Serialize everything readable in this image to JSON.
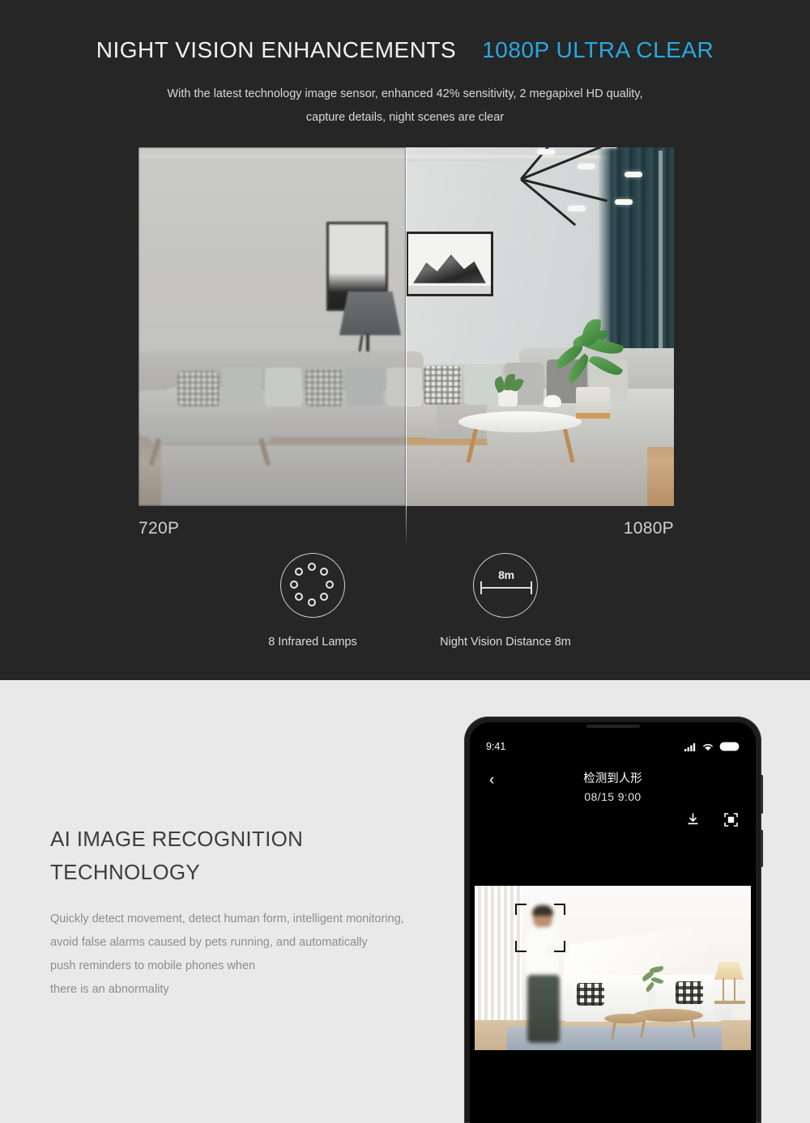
{
  "theme": {
    "dark_bg": "#262626",
    "light_bg": "#E9E9E9",
    "accent_blue": "#29A8E0",
    "heading_light": "#F2F2F2",
    "body_muted": "#8D8D8D"
  },
  "night_vision": {
    "headline_main": "NIGHT VISION ENHANCEMENTS",
    "headline_accent": "1080P ULTRA CLEAR",
    "subhead_line1": "With the latest technology image sensor, enhanced 42% sensitivity, 2 megapixel HD quality,",
    "subhead_line2": "capture details, night scenes are clear",
    "comparison": {
      "left_label": "720P",
      "right_label": "1080P"
    },
    "features": [
      {
        "icon": "infrared-lamps-icon",
        "caption": "8 Infrared Lamps",
        "lamp_count": 8
      },
      {
        "icon": "night-vision-distance-icon",
        "caption": "Night Vision Distance 8m",
        "distance_label": "8m"
      }
    ]
  },
  "ai_recognition": {
    "title_line1": "AI IMAGE RECOGNITION",
    "title_line2": "TECHNOLOGY",
    "body_line1": "Quickly detect movement, detect human form, intelligent monitoring,",
    "body_line2": "avoid false alarms caused by pets running, and automatically",
    "body_line3": "push reminders to mobile phones when",
    "body_line4": "there is an abnormality",
    "phone": {
      "status_time": "9:41",
      "status_icons": [
        "signal-icon",
        "wifi-icon",
        "battery-icon"
      ],
      "back_label": "‹",
      "screen_title": "检测到人形",
      "screen_subtitle": "08/15  9:00",
      "actions": [
        "download-icon",
        "snapshot-icon"
      ]
    }
  }
}
